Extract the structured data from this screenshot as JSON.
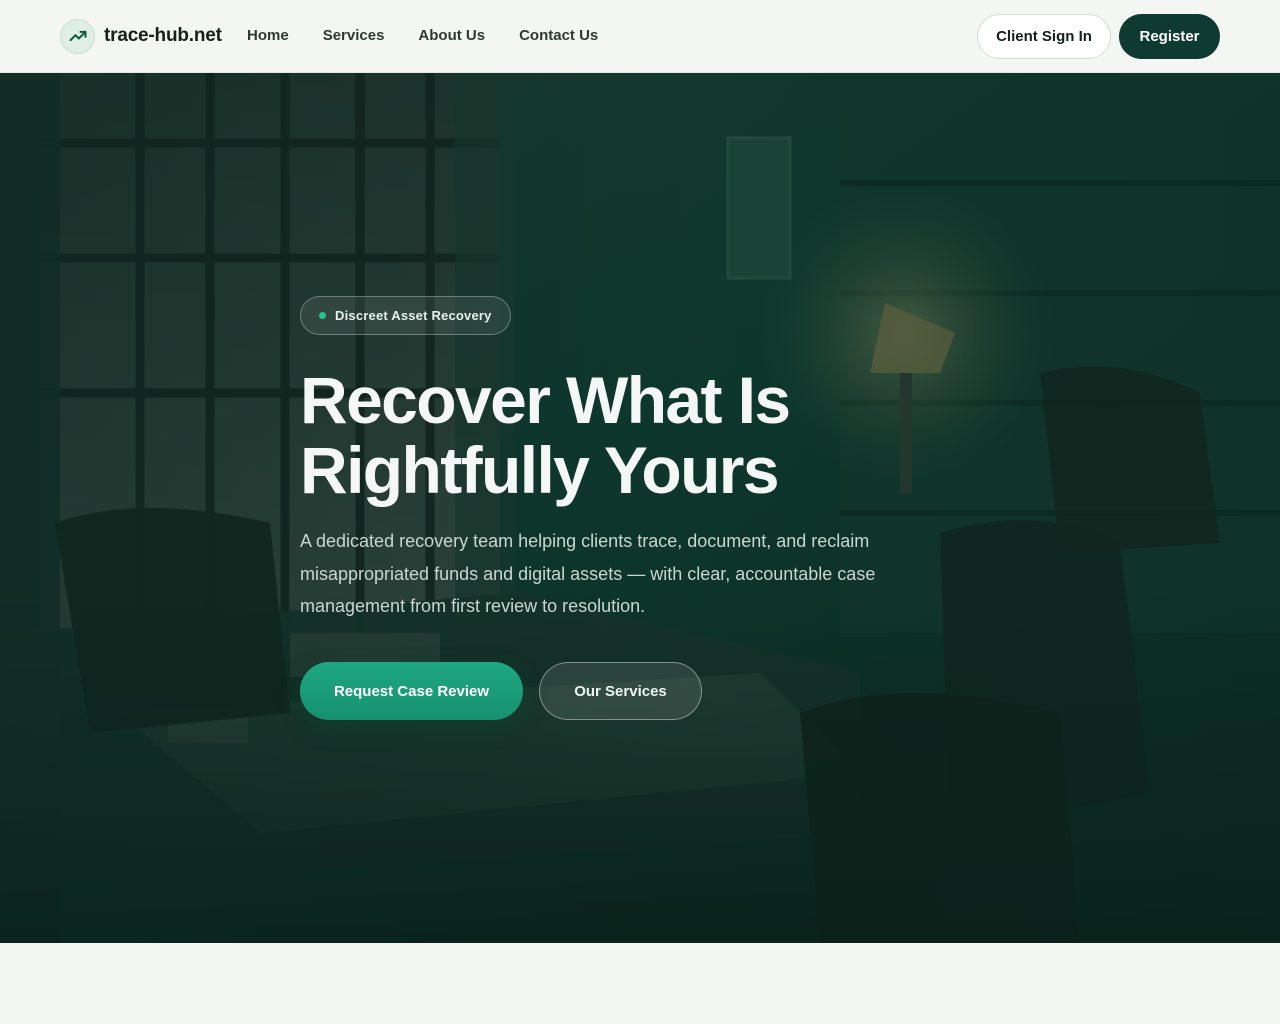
{
  "brand": {
    "name": "trace-hub.net",
    "icon": "trending-up-icon",
    "accent_color": "#0f3a31"
  },
  "nav": {
    "items": [
      {
        "label": "Home"
      },
      {
        "label": "Services"
      },
      {
        "label": "About Us"
      },
      {
        "label": "Contact Us"
      }
    ]
  },
  "header_actions": {
    "signin_label": "Client Sign In",
    "register_label": "Register"
  },
  "hero": {
    "badge": "Discreet Asset Recovery",
    "badge_dot_color": "#22c58e",
    "title_line1": "Recover What Is",
    "title_line2": "Rightfully Yours",
    "description": "A dedicated recovery team helping clients trace, document, and reclaim misappropriated funds and digital assets — with clear, accountable case management from first review to resolution.",
    "primary_cta": "Request Case Review",
    "secondary_cta": "Our Services",
    "primary_color": "#1fa783"
  }
}
